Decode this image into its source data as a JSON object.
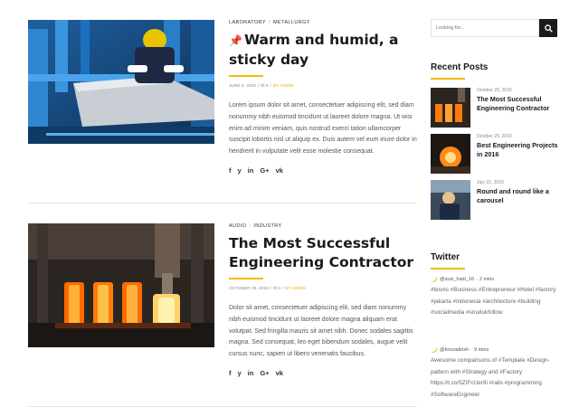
{
  "posts": [
    {
      "categories": [
        "LABORATORY",
        "METALLURGY"
      ],
      "pin": "📌",
      "title": "Warm and humid, a sticky day",
      "date": "JUNE 9, 2015",
      "comments": "0",
      "author": "BY ADMIN",
      "excerpt": "Lorem ipsum dolor sit amet, consectetuer adipiscing elit, sed diam nonummy nibh euismod tincidunt ut laoreet dolore magna. Ut wisi enim ad minim veniam, quis nostrud exerci tation ullamcorper suscipit lobortis nisl ut aliquip ex. Duis autem vel eum iriure dolor in hendrerit in vulputate velit esse molestie consequat.",
      "share": [
        "f",
        "y",
        "in",
        "G+",
        "vk"
      ]
    },
    {
      "categories": [
        "AUDIO",
        "INDUSTRY"
      ],
      "pin": "",
      "title": "The Most Successful Engineering Contractor",
      "date": "OCTOBER 29, 2016",
      "comments": "0",
      "author": "BY ADMIN",
      "excerpt": "Dolor sit amet, consectetuer adipiscing elit, sed diam nonummy nibh euismod tincidunt ut laoreet dolore magna aliquam erat volutpat. Sed fringilla mauris sit amet nibh. Donec sodales sagittis magna. Sed consequat, leo eget bibendum sodales, augue velit cursus nunc, sapien ut libero venenatis faucibus.",
      "share": [
        "f",
        "y",
        "in",
        "G+",
        "vk"
      ]
    }
  ],
  "sidebar": {
    "search_placeholder": "Looking for...",
    "recent_title": "Recent Posts",
    "recent": [
      {
        "date": "October 29, 2016",
        "title": "The Most Successful Engineering Contractor"
      },
      {
        "date": "October 29, 2016",
        "title": "Best Engineering Projects in 2016"
      },
      {
        "date": "July 22, 2015",
        "title": "Round and round like a carousel"
      }
    ],
    "twitter_title": "Twitter",
    "tweets": [
      {
        "handle": "@suzi_hadi_16",
        "time": "2 mins",
        "text": "#bisnis #Business #Entrepreneur #Hotel #factory #jakarta #indonesia #architecture #building #socialmedia #snudukfollow"
      },
      {
        "handle": "@krozadirish",
        "time": "9 mins",
        "text": "Awesome comparisons of #Template #Design-pattern with #Strategy and #Factory https://t.co/5ZIFcUer9i #rails #programming #SoftwareEngineer"
      }
    ]
  },
  "colors": {
    "accent": "#f5b800",
    "dark": "#1b1b1b"
  }
}
